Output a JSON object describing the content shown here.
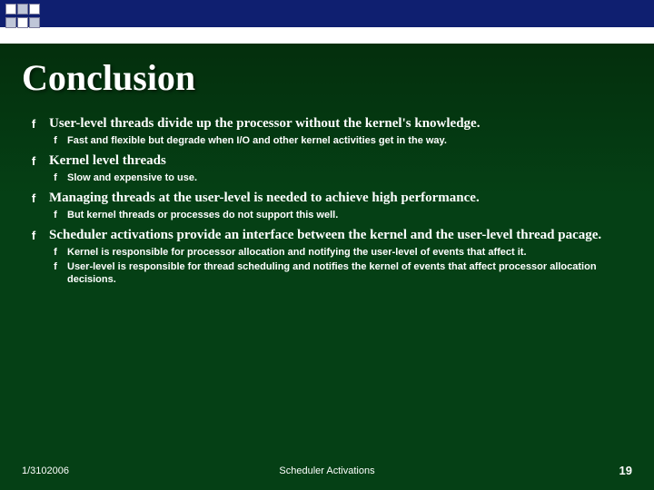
{
  "header": {
    "title": "Conclusion"
  },
  "bullets": {
    "b1": {
      "text": "User-level threads divide up the processor without the kernel's knowledge.",
      "s1": "Fast and flexible but degrade when I/O and other kernel activities get in the way."
    },
    "b2": {
      "text": "Kernel level threads",
      "s1": "Slow and expensive to use."
    },
    "b3": {
      "text": "Managing threads at the user-level is needed to achieve high performance.",
      "s1": "But kernel threads or processes do not support this well."
    },
    "b4": {
      "text": "Scheduler activations provide an interface between the kernel and the user-level thread pacage.",
      "s1": "Kernel is responsible for processor allocation and notifying the user-level of events that affect it.",
      "s2": "User-level is responsible for thread scheduling and notifies the kernel of events that affect processor allocation decisions."
    }
  },
  "footer": {
    "date": "1/3102006",
    "mid": "Scheduler Activations",
    "page": "19"
  },
  "glyph": "f"
}
